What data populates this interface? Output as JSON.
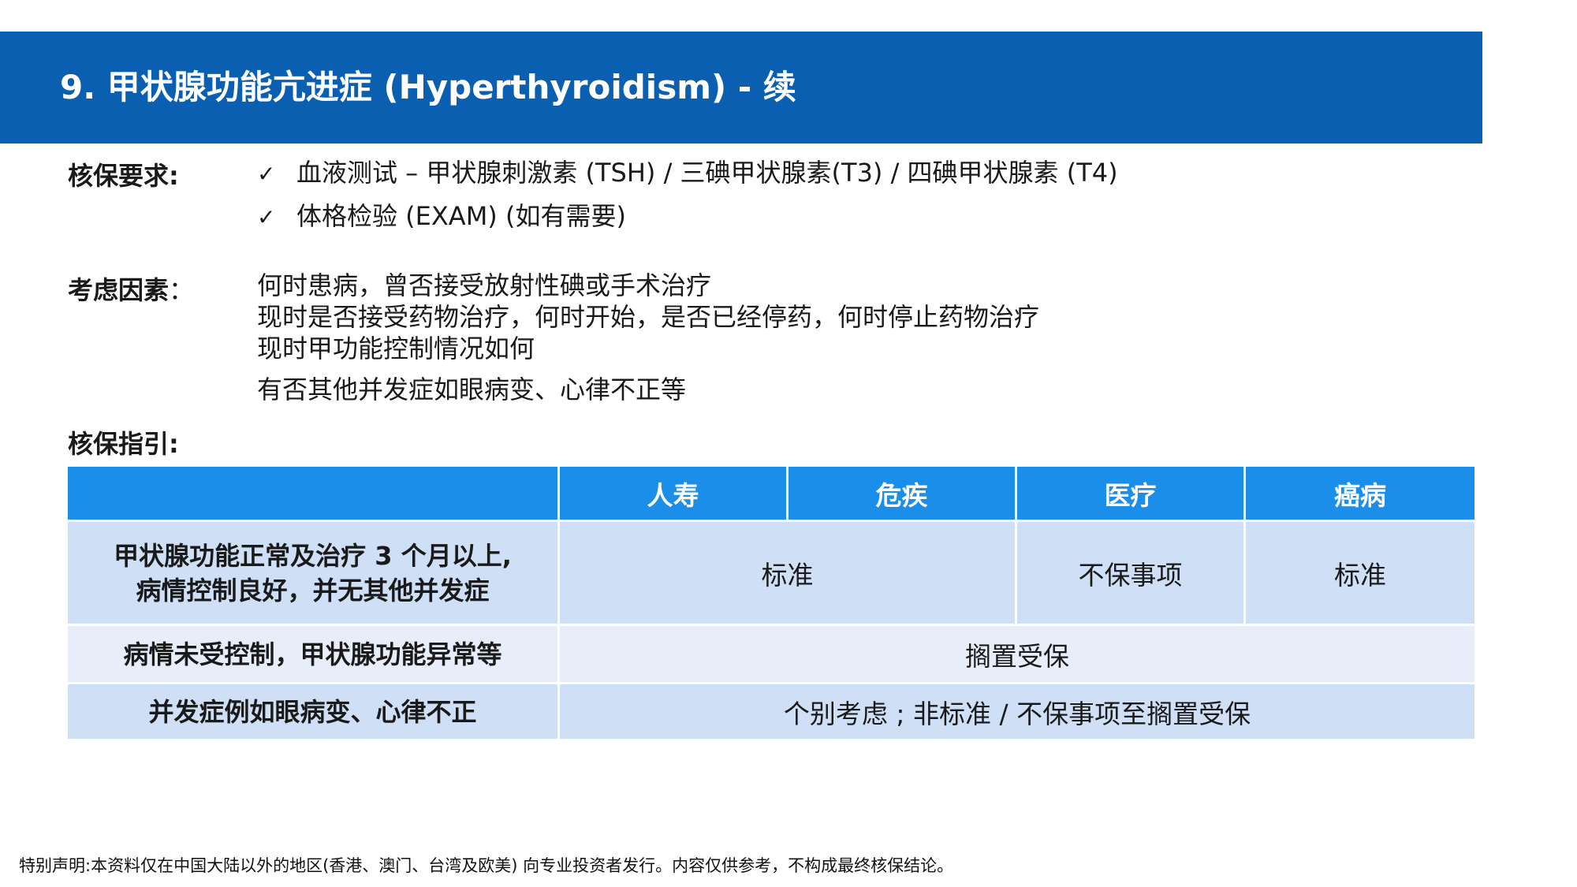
{
  "title": "9. 甲状腺功能亢进症 (Hyperthyroidism) - 续",
  "requirements": {
    "label": "核保要求:",
    "check": "✓",
    "items": [
      "血液测试 – 甲状腺刺激素 (TSH) / 三碘甲状腺素(T3) / 四碘甲状腺素 (T4)",
      "体格检验 (EXAM) (如有需要)"
    ]
  },
  "factors": {
    "label": "考虑因素",
    "colon": "：",
    "items": [
      "何时患病，曾否接受放射性碘或手术治疗",
      "现时是否接受药物治疗，何时开始，是否已经停药，何时停止药物治疗",
      "现时甲功能控制情况如何",
      "有否其他并发症如眼病变、心律不正等"
    ]
  },
  "guidelines": {
    "label": "核保指引:",
    "headers": [
      "",
      "人寿",
      "危疾",
      "医疗",
      "癌病"
    ],
    "rows": [
      {
        "condition_line1": "甲状腺功能正常及治疗 3 个月以上,",
        "condition_line2": "病情控制良好，并无其他并发症",
        "life_ci": "标准",
        "medical": "不保事项",
        "cancer": "标准"
      },
      {
        "condition": "病情未受控制，甲状腺功能异常等",
        "decision": "搁置受保"
      },
      {
        "condition": "并发症例如眼病变、心律不正",
        "decision": "个别考虑 ; 非标准 / 不保事项至搁置受保"
      }
    ]
  },
  "disclaimer": "特别声明:本资料仅在中国大陆以外的地区(香港、澳门、台湾及欧美) 向专业投资者发行。内容仅供参考，不构成最终核保结论。",
  "colors": {
    "header_band": "#0b5fb0",
    "table_header": "#1a8ee8",
    "row_dark": "#cfdff6",
    "row_light": "#e7eefa"
  }
}
